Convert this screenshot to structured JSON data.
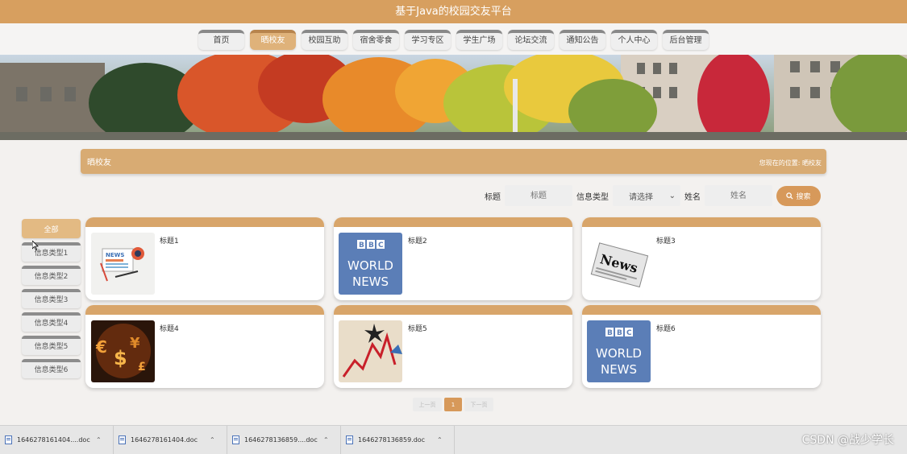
{
  "header": {
    "title": "基于Java的校园交友平台"
  },
  "nav": {
    "items": [
      {
        "label": "首页",
        "active": false
      },
      {
        "label": "晒校友",
        "active": true
      },
      {
        "label": "校园互助",
        "active": false
      },
      {
        "label": "宿舍零食",
        "active": false
      },
      {
        "label": "学习专区",
        "active": false
      },
      {
        "label": "学生广场",
        "active": false
      },
      {
        "label": "论坛交流",
        "active": false
      },
      {
        "label": "通知公告",
        "active": false
      },
      {
        "label": "个人中心",
        "active": false
      },
      {
        "label": "后台管理",
        "active": false
      }
    ]
  },
  "section": {
    "title": "晒校友",
    "breadcrumb_prefix": "您现在的位置:",
    "breadcrumb_current": "晒校友"
  },
  "search": {
    "title_label": "标题",
    "title_placeholder": "标题",
    "type_label": "信息类型",
    "type_select_value": "请选择",
    "name_label": "姓名",
    "name_placeholder": "姓名",
    "button_label": "搜索",
    "button_icon": "search-icon"
  },
  "categories": [
    {
      "label": "全部",
      "active": true
    },
    {
      "label": "信息类型1",
      "active": false
    },
    {
      "label": "信息类型2",
      "active": false
    },
    {
      "label": "信息类型3",
      "active": false
    },
    {
      "label": "信息类型4",
      "active": false
    },
    {
      "label": "信息类型5",
      "active": false
    },
    {
      "label": "信息类型6",
      "active": false
    }
  ],
  "cards": [
    {
      "title": "标题1",
      "image": "news-illustration"
    },
    {
      "title": "标题2",
      "image": "bbc-world-news-logo",
      "image_text": [
        "BBC",
        "WORLD",
        "NEWS"
      ]
    },
    {
      "title": "标题3",
      "image": "newspaper-news",
      "image_text": [
        "News"
      ]
    },
    {
      "title": "标题4",
      "image": "money-symbols"
    },
    {
      "title": "标题5",
      "image": "stock-chart"
    },
    {
      "title": "标题6",
      "image": "bbc-world-news-logo",
      "image_text": [
        "BBC",
        "WORLD",
        "NEWS"
      ]
    }
  ],
  "pagination": {
    "prev": "上一页",
    "current": "1",
    "next": "下一页"
  },
  "downloads": [
    {
      "name": "1646278161404....doc"
    },
    {
      "name": "1646278161404.doc"
    },
    {
      "name": "1646278136859....doc"
    },
    {
      "name": "1646278136859.doc"
    }
  ],
  "watermark": "CSDN @战少学长",
  "colors": {
    "accent": "#d7995a",
    "header": "#d79f5f",
    "card_top": "#d8a56a"
  }
}
